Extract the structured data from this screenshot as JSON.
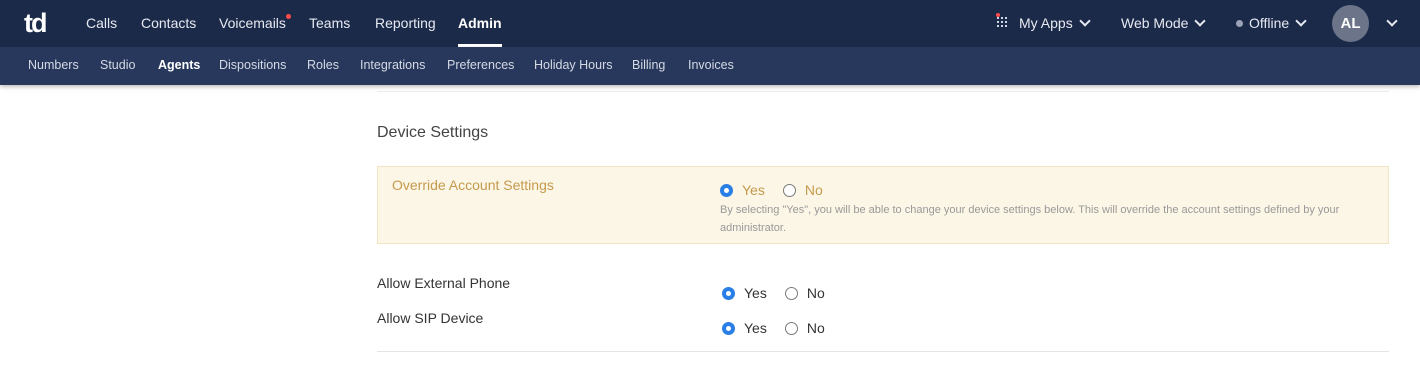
{
  "topbar": {
    "logo_text": "td",
    "nav": [
      {
        "label": "Calls"
      },
      {
        "label": "Contacts"
      },
      {
        "label": "Voicemails"
      },
      {
        "label": "Teams"
      },
      {
        "label": "Reporting"
      },
      {
        "label": "Admin"
      }
    ],
    "active_nav": "Admin",
    "my_apps_label": "My Apps",
    "web_mode_label": "Web Mode",
    "status_label": "Offline",
    "avatar_initials": "AL"
  },
  "subnav": {
    "items": [
      {
        "label": "Numbers"
      },
      {
        "label": "Studio"
      },
      {
        "label": "Agents"
      },
      {
        "label": "Dispositions"
      },
      {
        "label": "Roles"
      },
      {
        "label": "Integrations"
      },
      {
        "label": "Preferences"
      },
      {
        "label": "Holiday Hours"
      },
      {
        "label": "Billing"
      },
      {
        "label": "Invoices"
      }
    ],
    "active": "Agents"
  },
  "device_settings": {
    "title": "Device Settings",
    "override": {
      "label": "Override Account Settings",
      "yes_label": "Yes",
      "no_label": "No",
      "selected": "Yes",
      "help_text": "By selecting \"Yes\", you will be able to change your device settings below. This will override the account settings defined by your administrator."
    },
    "allow_external_phone": {
      "label": "Allow External Phone",
      "yes_label": "Yes",
      "no_label": "No",
      "selected": "Yes"
    },
    "allow_sip_device": {
      "label": "Allow SIP Device",
      "yes_label": "Yes",
      "no_label": "No",
      "selected": "Yes"
    }
  },
  "colors": {
    "topbar_bg": "#1c2a4a",
    "subbar_bg": "#28385c",
    "override_bg": "#fcf6e6",
    "override_text": "#c49a4d",
    "radio_checked": "#2a7fe6",
    "notification_dot": "#ff4a4a"
  }
}
